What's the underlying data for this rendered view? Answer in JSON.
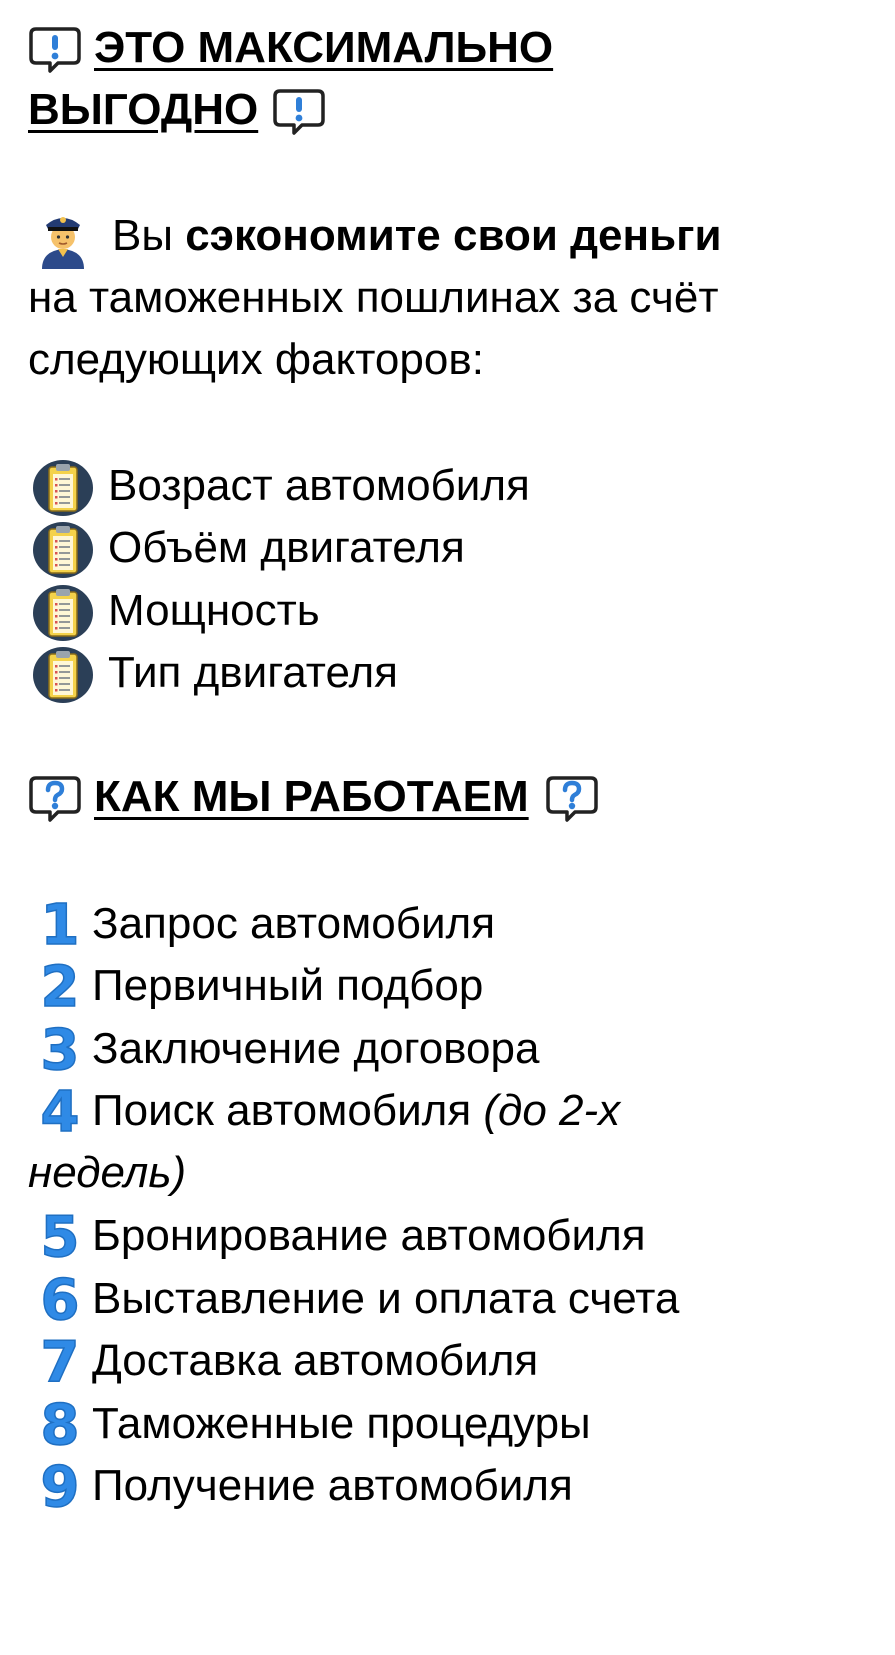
{
  "heading1": {
    "line1": "ЭТО МАКСИМАЛЬНО ",
    "line2": "ВЫГОДНО",
    "icon": "exclamation-speech-bubble-icon"
  },
  "savings": {
    "icon": "police-officer-icon",
    "prefix": "Вы ",
    "bold": "сэкономите свои деньги",
    "line2": "на таможенных пошлинах за счёт",
    "line3": "следующих факторов:"
  },
  "factors": {
    "icon": "clipboard-icon",
    "items": [
      "Возраст автомобиля",
      "Объём двигателя",
      "Мощность",
      "Тип двигателя"
    ]
  },
  "heading2": {
    "text": "КАК МЫ РАБОТАЕМ",
    "icon": "question-speech-bubble-icon"
  },
  "steps": {
    "icon_color": "#2f8ae6",
    "items": [
      {
        "num": "1",
        "text": "Запрос автомобиля"
      },
      {
        "num": "2",
        "text": "Первичный подбор"
      },
      {
        "num": "3",
        "text": "Заключение договора"
      },
      {
        "num": "4",
        "text": "Поиск автомобиля ",
        "note_a": "(до 2-х",
        "note_b": "недель)"
      },
      {
        "num": "5",
        "text": "Бронирование автомобиля"
      },
      {
        "num": "6",
        "text": "Выставление и оплата счета"
      },
      {
        "num": "7",
        "text": "Доставка автомобиля"
      },
      {
        "num": "8",
        "text": "Таможенные процедуры"
      },
      {
        "num": "9",
        "text": "Получение автомобиля"
      }
    ]
  }
}
